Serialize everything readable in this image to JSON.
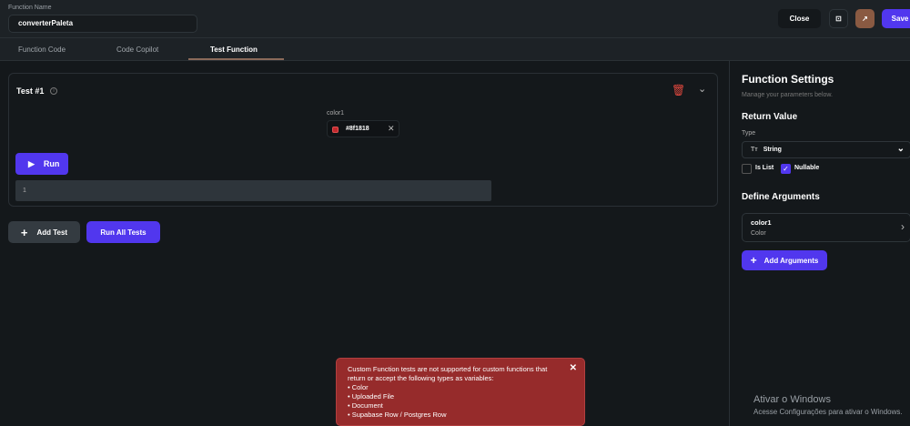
{
  "header": {
    "function_name_label": "Function Name",
    "function_name": "converterPaleta",
    "close": "Close",
    "save": "Save"
  },
  "tabs": [
    "Function Code",
    "Code Copilot",
    "Test Function"
  ],
  "test": {
    "title": "Test #1",
    "param_label": "color1",
    "param_value": "#8f1818",
    "run": "Run",
    "output_line": "1"
  },
  "actions": {
    "add_test": "Add Test",
    "run_all": "Run All Tests"
  },
  "settings": {
    "title": "Function Settings",
    "subtitle": "Manage your parameters below.",
    "return_value": "Return Value",
    "type_label": "Type",
    "type_value": "String",
    "is_list": "Is List",
    "nullable": "Nullable",
    "is_list_checked": false,
    "nullable_checked": true,
    "define_arguments": "Define Arguments",
    "arguments": [
      {
        "name": "color1",
        "type": "Color"
      }
    ],
    "add_arguments": "Add Arguments"
  },
  "toast": {
    "message": "Custom Function tests are not supported for custom functions that return or accept the following types as variables:",
    "items": [
      "• Color",
      "• Uploaded File",
      "• Document",
      "• Supabase Row / Postgres Row"
    ]
  },
  "watermark": {
    "title": "Ativar o Windows",
    "subtitle": "Acesse Configurações para ativar o Windows."
  },
  "colors": {
    "accent": "#5137ee",
    "danger": "#962b2b",
    "swatch": "#c1272d"
  }
}
